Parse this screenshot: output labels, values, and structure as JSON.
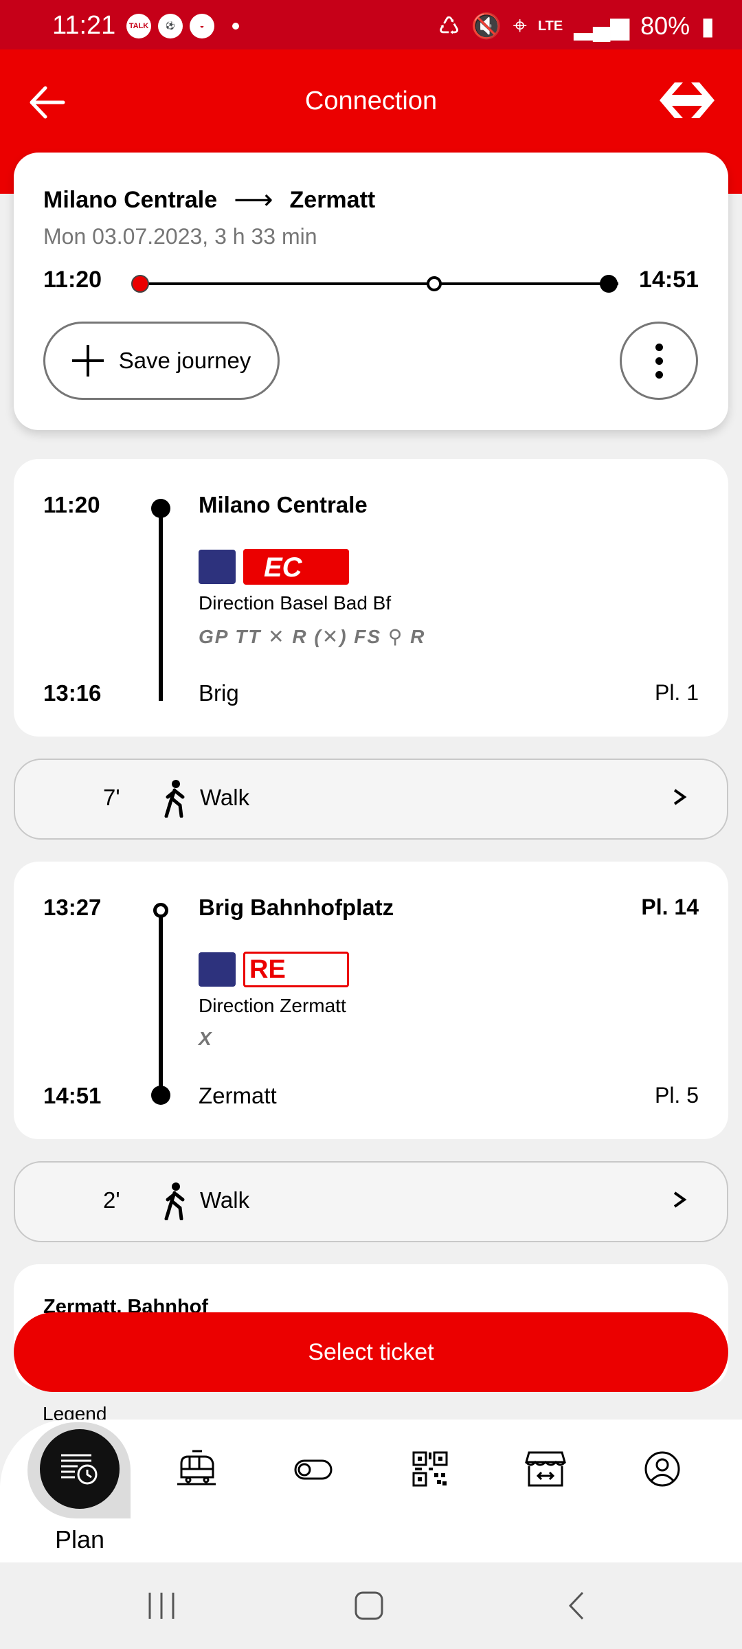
{
  "status_bar": {
    "time": "11:21",
    "notifications": [
      "TALK",
      "ball",
      "bowl"
    ],
    "network": "LTE",
    "battery": "80%"
  },
  "header": {
    "title": "Connection",
    "back_icon": "arrow-left-icon",
    "logo_icon": "sbb-logo-icon"
  },
  "summary": {
    "from": "Milano Centrale",
    "to": "Zermatt",
    "date_duration": "Mon 03.07.2023, 3 h 33 min",
    "departure": "11:20",
    "arrival": "14:51",
    "save_label": "Save journey"
  },
  "legs": [
    {
      "dep_time": "11:20",
      "dep_stop": "Milano Centrale",
      "product": "EC",
      "direction": "Direction Basel Bad Bf",
      "attributes": "GP TT ✕ R (✕) FS ⚲ R",
      "arr_time": "13:16",
      "arr_stop": "Brig",
      "arr_platform": "Pl. 1"
    },
    {
      "dep_time": "13:27",
      "dep_stop": "Brig Bahnhofplatz",
      "dep_platform": "Pl. 14",
      "product": "RE",
      "direction": "Direction Zermatt",
      "attributes": "X",
      "arr_time": "14:51",
      "arr_stop": "Zermatt",
      "arr_platform": "Pl. 5"
    }
  ],
  "walks": [
    {
      "minutes": "7'",
      "label": "Walk"
    },
    {
      "minutes": "2'",
      "label": "Walk"
    }
  ],
  "final_stop": "Zermatt, Bahnhof",
  "select_ticket_label": "Select ticket",
  "legend_label": "Legend",
  "bottom_nav": {
    "active_label": "Plan",
    "items": [
      "plan-icon",
      "train-icon",
      "toggle-icon",
      "qr-code-icon",
      "shop-icon",
      "profile-icon"
    ]
  },
  "colors": {
    "brand_red": "#eb0000",
    "status_bar": "#c60018",
    "train_blue": "#2d327d"
  }
}
